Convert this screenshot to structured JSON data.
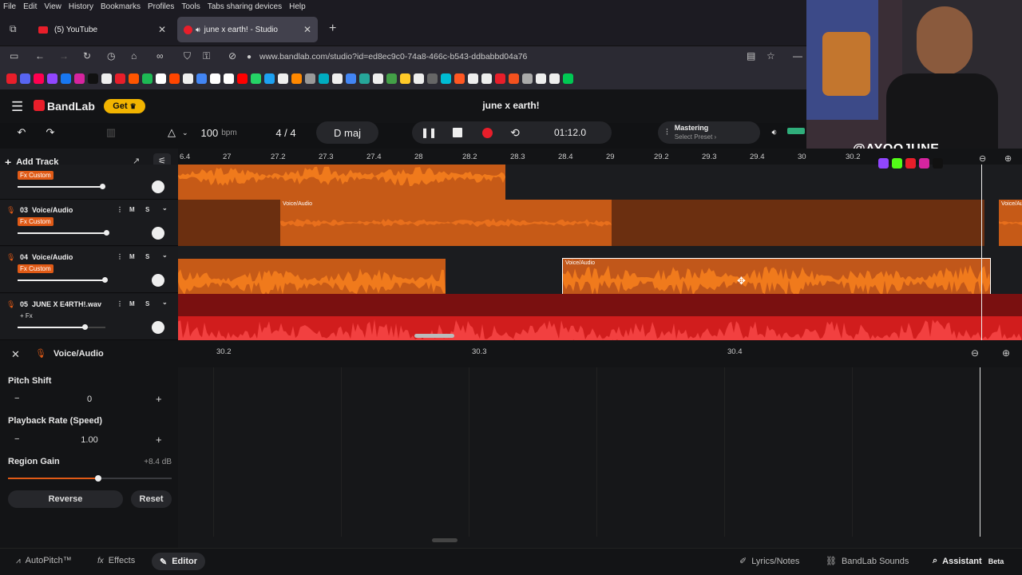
{
  "menu": [
    "File",
    "Edit",
    "View",
    "History",
    "Bookmarks",
    "Profiles",
    "Tools",
    "Tabs sharing devices",
    "Help"
  ],
  "tabs": [
    {
      "title": "(5) YouTube",
      "active": false
    },
    {
      "title": "june x earth! - Studio",
      "active": true
    }
  ],
  "url": "www.bandlab.com/studio?id=ed8ec9c0-74a8-466c-b543-ddbabbd04a76",
  "app": {
    "brand": "BandLab",
    "get_label": "Get",
    "project_title": "june x earth!",
    "bpm_value": "100",
    "bpm_unit": "bpm",
    "time_signature": "4 / 4",
    "key": "D maj",
    "time_display": "01:12.0",
    "mastering_label": "Mastering",
    "mastering_preset": "Select Preset ›",
    "add_track_label": "Add Track"
  },
  "ruler_ticks": [
    "6.4",
    "27",
    "27.2",
    "27.3",
    "27.4",
    "28",
    "28.2",
    "28.3",
    "28.4",
    "29",
    "29.2",
    "29.3",
    "29.4",
    "30",
    "30.2"
  ],
  "tracks": [
    {
      "num": "",
      "name": "",
      "badge": "Fx Custom",
      "slider": 0.95
    },
    {
      "num": "03",
      "name": "Voice/Audio",
      "badge": "Fx Custom",
      "slider": 1.0
    },
    {
      "num": "04",
      "name": "Voice/Audio",
      "badge": "Fx Custom",
      "slider": 0.98
    },
    {
      "num": "05",
      "name": "JUNE X E4RTH!.wav",
      "badge": "+ Fx",
      "slider": 0.75
    }
  ],
  "region_label": "Voice/Audio",
  "editor": {
    "title": "Voice/Audio",
    "pitch_label": "Pitch Shift",
    "pitch_value": "0",
    "rate_label": "Playback Rate (Speed)",
    "rate_value": "1.00",
    "gain_label": "Region Gain",
    "gain_value": "+8.4 dB",
    "gain_level": 0.55,
    "reverse_label": "Reverse",
    "reset_label": "Reset",
    "ruler_ticks": [
      "30.2",
      "30.3",
      "30.4"
    ]
  },
  "bottom": {
    "autopitch": "AutoPitch™",
    "effects": "Effects",
    "editor": "Editor",
    "lyrics": "Lyrics/Notes",
    "sounds": "BandLab Sounds",
    "assistant": "Assistant",
    "beta": "Beta"
  },
  "overlay_handle": "@AYOOJUNE",
  "colors": {
    "accent": "#e05a16",
    "record": "#e81e2a",
    "region": "#c65a17",
    "region_bright": "#f07a1c",
    "track5": "#d11d1d",
    "gold": "#f2b400"
  }
}
